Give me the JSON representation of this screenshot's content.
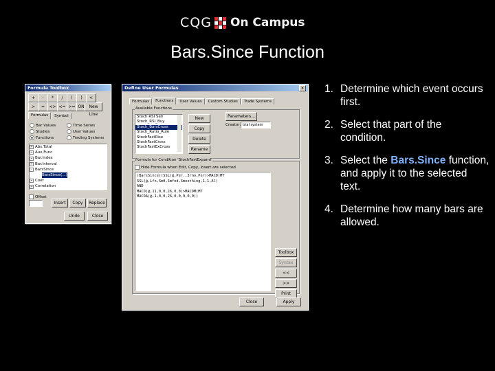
{
  "logo": {
    "brand": "CQG",
    "suffix": "On Campus",
    "mark_colors": [
      "#e03030",
      "#ffffff",
      "#e03030",
      "#ffffff",
      "#e03030",
      "#ffffff",
      "#e03030",
      "#ffffff",
      "#e03030"
    ]
  },
  "slide_title": "Bars.Since Function",
  "toolbox": {
    "title": "Formula Toolbox",
    "keys": [
      "+",
      "-",
      "*",
      "/",
      "(",
      ")",
      "<",
      ">",
      "=",
      "<>",
      "<=",
      ">=",
      "ON",
      "New Line"
    ],
    "tabs": [
      "Formulas",
      "Symbol"
    ],
    "radios": [
      {
        "label": "Bar Values",
        "checked": false
      },
      {
        "label": "Studies",
        "checked": false
      },
      {
        "label": "Functions",
        "checked": true
      },
      {
        "label": "Time Series",
        "checked": false
      },
      {
        "label": "User Values",
        "checked": false
      },
      {
        "label": "Trading Systems",
        "checked": false
      }
    ],
    "tree": [
      {
        "sign": "+",
        "label": "Abs.Total"
      },
      {
        "sign": "+",
        "label": "Aux.Func"
      },
      {
        "sign": "+",
        "label": "Bar.Index"
      },
      {
        "sign": "+",
        "label": "Bar.Interval"
      },
      {
        "sign": "-",
        "label": "BarsSince"
      },
      {
        "sign": "",
        "label": "BarsSince(...)",
        "selected": true
      },
      {
        "sign": "+",
        "label": "Coef"
      },
      {
        "sign": "+",
        "label": "Correlation"
      }
    ],
    "offset_label": "Offset",
    "buttons": [
      "Insert",
      "Copy",
      "Replace",
      "Undo",
      "Close"
    ]
  },
  "define": {
    "title": "Define User Formulas",
    "tabs": [
      "Formulas",
      "Functions",
      "User Values",
      "Custom Studies",
      "Trade Systems"
    ],
    "available_label": "Available Functions",
    "functions": [
      "Stoch RSI Sell",
      "Stoch_RSI_Buy",
      "Stoch_BarsCross",
      "Stoch_Ratio_Rule",
      "StochFastRise",
      "StochFastCross",
      "StochFastExCross"
    ],
    "side_buttons": [
      "New",
      "Copy",
      "Delete",
      "Rename"
    ],
    "parameters_button": "Parameters...",
    "creator_label": "Creator:",
    "creator_value": "trial system",
    "group_label": "Formula for Condition 'StochFastExpand'",
    "hide_label": "Hide Formula when Edit, Copy, Insert are selected",
    "code_lines": [
      {
        "text": "(BarsSince((SSL(@,Per.,3rno,Per)>MACD(MT",
        "hl": ""
      },
      {
        "text": "SSL(@,Lfn,Sm0,Smfnd,Smoothing,1,1,Al)",
        "hl": "1,1,0"
      },
      {
        "text": "AND",
        "hl": ""
      },
      {
        "text": "MACD(@,11,0,0,26,0,0)>MACDM(MT",
        "hl": ""
      },
      {
        "text": "MACDA(@,1,0,0,26,0,0,9,0,0))",
        "hl": ""
      }
    ],
    "right_buttons": [
      "Toolbox",
      "Syntax",
      "<<",
      ">>",
      "Print"
    ],
    "bottom_buttons": [
      "Close",
      "Apply"
    ]
  },
  "steps": [
    {
      "num": "1.",
      "parts": [
        {
          "t": "Determine which event occurs first."
        }
      ]
    },
    {
      "num": "2.",
      "parts": [
        {
          "t": "Select that part of the condition."
        }
      ]
    },
    {
      "num": "3.",
      "parts": [
        {
          "t": "Select the "
        },
        {
          "t": "Bars.Since",
          "accent": true
        },
        {
          "t": " function, and apply it to the selected text."
        }
      ]
    },
    {
      "num": "4.",
      "parts": [
        {
          "t": "Determine how many bars are allowed."
        }
      ]
    }
  ],
  "colors": {
    "accent": "#7fb3ff",
    "title_bar": "#0a246a",
    "window_bg": "#d4d0c8"
  }
}
